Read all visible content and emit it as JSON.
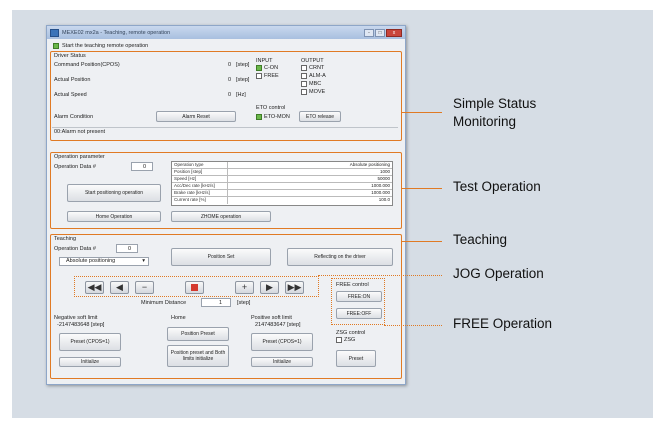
{
  "window": {
    "title": "MEXE02 mx2a - Teaching, remote operation",
    "min": "-",
    "max": "□",
    "close": "x"
  },
  "start_check_label": "Start the teaching remote operation",
  "driver_status": {
    "title": "Driver Status",
    "command_position_label": "Command Position(CPOS)",
    "command_position_value": "0",
    "command_position_unit": "[step]",
    "actual_position_label": "Actual Position",
    "actual_position_value": "0",
    "actual_position_unit": "[step]",
    "actual_speed_label": "Actual Speed",
    "actual_speed_value": "0",
    "actual_speed_unit": "[Hz]",
    "alarm_condition_label": "Alarm Condition",
    "alarm_reset_label": "Alarm Reset",
    "alarm_message": "00:Alarm not present",
    "input_title": "INPUT",
    "inputs": [
      "C-ON",
      "FREE"
    ],
    "output_title": "OUTPUT",
    "outputs": [
      "CRNT",
      "ALM-A",
      "MBC",
      "MOVE"
    ],
    "eto_title": "ETO control",
    "eto_mon_label": "ETO-MON",
    "eto_release_label": "ETO release"
  },
  "operation_parameter": {
    "title": "Operation parameter",
    "op_data_label": "Operation Data #",
    "op_data_value": "0",
    "start_button": "Start positioning operation",
    "home_button": "Home Operation",
    "zhome_button": "ZHOME operation",
    "table": [
      {
        "k": "Operation type",
        "v": "Absolute positioning"
      },
      {
        "k": "Position [step]",
        "v": "1000"
      },
      {
        "k": "Speed [Hz]",
        "v": "50000"
      },
      {
        "k": "Acc/Dec rate [kHz/s]",
        "v": "1000.000"
      },
      {
        "k": "Brake rate [kHz/s]",
        "v": "1000.000"
      },
      {
        "k": "Current rate [%]",
        "v": "100.0"
      }
    ]
  },
  "teaching": {
    "title": "Teaching",
    "op_data_label": "Operation Data #",
    "op_data_value": "0",
    "mode_select": "Absolute positioning",
    "position_set_button": "Position Set",
    "reflect_button": "Reflecting on the driver",
    "min_distance_label": "Minimum Distance",
    "min_distance_value": "1",
    "min_distance_unit": "[step]",
    "neg_soft_label": "Negative soft limit",
    "neg_soft_value": "-2147483648 [step]",
    "home_label": "Home",
    "pos_soft_label": "Positive soft limit",
    "pos_soft_value": "2147483647 [step]",
    "preset_cpos_button": "Preset (CPOS=1)",
    "position_preset_button": "Position Preset",
    "position_preset_both_button": "Position preset and Both limits initialize",
    "initialize_button": "Initialize",
    "free_control_title": "FREE control",
    "free_on_button": "FREE:ON",
    "free_off_button": "FREE:OFF",
    "zsg_control_title": "ZSG control",
    "zsg_label": "ZSG",
    "preset_button": "Preset"
  },
  "jog": {
    "fast_back": "◀◀",
    "back": "◀",
    "minus": "−",
    "plus": "+",
    "fwd": "▶",
    "fast_fwd": "▶▶"
  },
  "callouts": {
    "simple_status": "Simple Status\nMonitoring",
    "test_operation": "Test Operation",
    "teaching": "Teaching",
    "jog_operation": "JOG Operation",
    "free_operation": "FREE Operation"
  },
  "colors": {
    "accent": "#e07a24",
    "panel": "#d6dde5",
    "status_on": "#6bb84a",
    "stop": "#d43a2e"
  }
}
